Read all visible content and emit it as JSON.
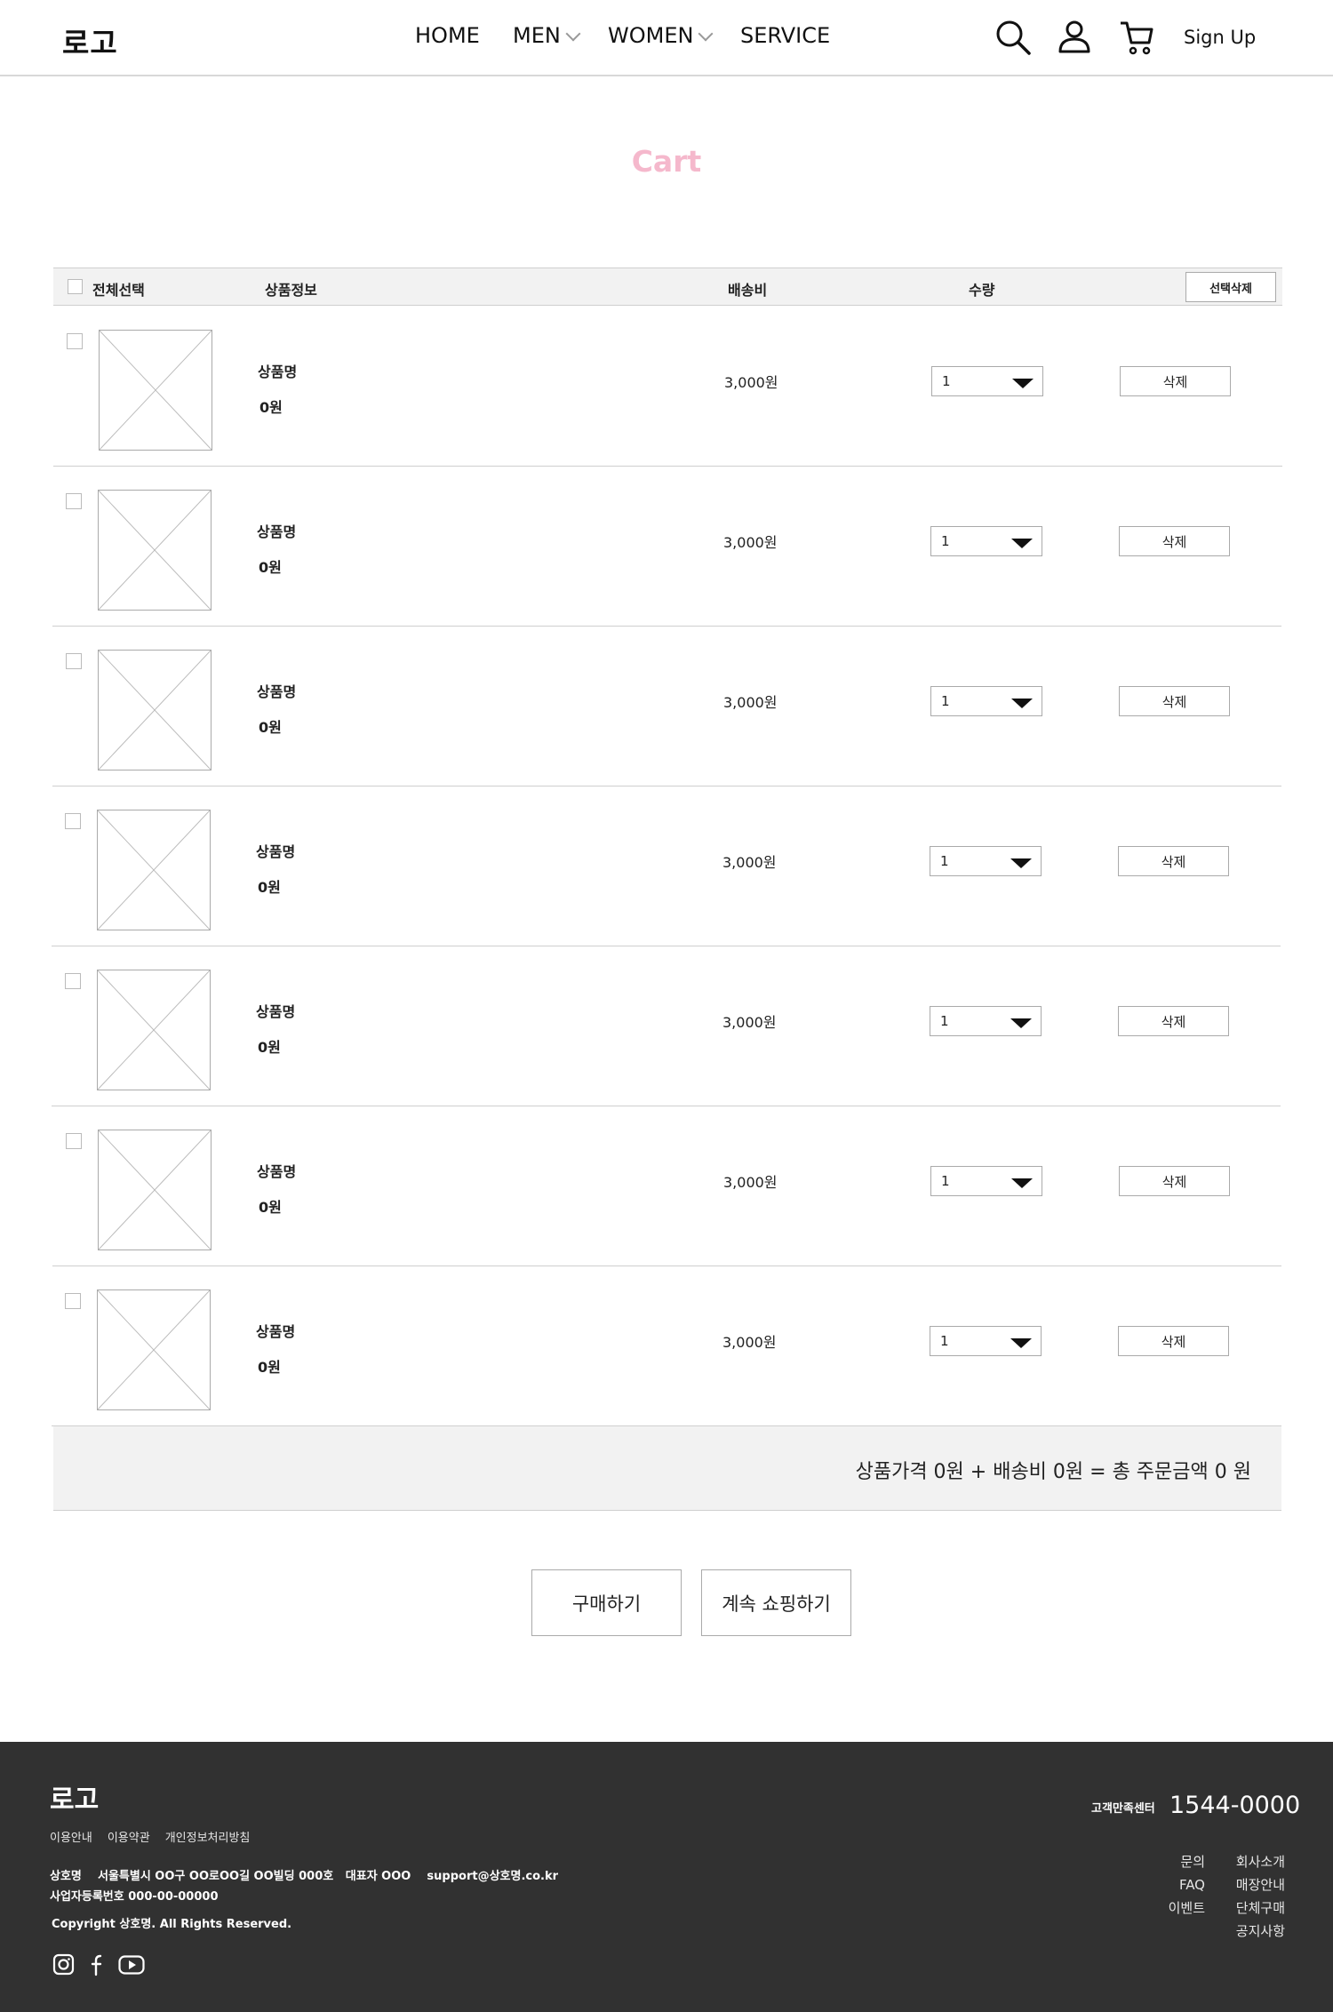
{
  "header": {
    "logo": "로고",
    "nav": [
      {
        "label": "HOME",
        "has_dropdown": false
      },
      {
        "label": "MEN",
        "has_dropdown": true
      },
      {
        "label": "WOMEN",
        "has_dropdown": true
      },
      {
        "label": "SERVICE",
        "has_dropdown": false
      }
    ],
    "icons": [
      "search-icon",
      "user-icon",
      "cart-icon"
    ],
    "signup": "Sign Up"
  },
  "page_title": "Cart",
  "colors": {
    "title_accent": "#f5b8cc",
    "footer_bg": "#313131",
    "table_header_bg": "#f2f2f2"
  },
  "table": {
    "select_all": "전체선택",
    "col_product": "상품정보",
    "col_shipping": "배송비",
    "col_qty": "수량",
    "delete_selected": "선택삭제"
  },
  "items": [
    {
      "name": "상품명",
      "price": "0원",
      "shipping": "3,000원",
      "qty": "1",
      "delete": "삭제"
    },
    {
      "name": "상품명",
      "price": "0원",
      "shipping": "3,000원",
      "qty": "1",
      "delete": "삭제"
    },
    {
      "name": "상품명",
      "price": "0원",
      "shipping": "3,000원",
      "qty": "1",
      "delete": "삭제"
    },
    {
      "name": "상품명",
      "price": "0원",
      "shipping": "3,000원",
      "qty": "1",
      "delete": "삭제"
    },
    {
      "name": "상품명",
      "price": "0원",
      "shipping": "3,000원",
      "qty": "1",
      "delete": "삭제"
    },
    {
      "name": "상품명",
      "price": "0원",
      "shipping": "3,000원",
      "qty": "1",
      "delete": "삭제"
    },
    {
      "name": "상품명",
      "price": "0원",
      "shipping": "3,000원",
      "qty": "1",
      "delete": "삭제"
    }
  ],
  "summary": "상품가격 0원 + 배송비 0원 = 총 주문금액 0 원",
  "buttons": {
    "buy": "구매하기",
    "continue": "계속 쇼핑하기"
  },
  "footer": {
    "logo": "로고",
    "links": [
      "이용안내",
      "이용약관",
      "개인정보처리방침"
    ],
    "company_line": "상호명    서울특별시 OO구 OO로OO길 OO빌딩 000호   대표자 OOO    support@상호명.co.kr",
    "business_no": "사업자등록번호 000-00-00000",
    "copyright": "Copyright 상호명. All Rights Reserved.",
    "social": [
      "instagram-icon",
      "facebook-icon",
      "youtube-icon"
    ],
    "cs_label": "고객만족센터",
    "cs_number": "1544-0000",
    "menu_col1": [
      "문의",
      "FAQ",
      "이벤트"
    ],
    "menu_col2": [
      "회사소개",
      "매장안내",
      "단체구매",
      "공지사항"
    ]
  }
}
